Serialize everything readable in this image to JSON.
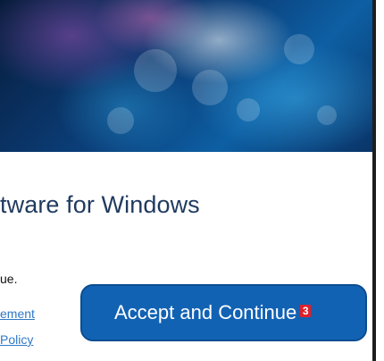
{
  "dialog": {
    "title_fragment": "tware for Windows",
    "body_fragment": "ue.",
    "link1_fragment": "ement",
    "link2_fragment": "Policy",
    "accept_label": "Accept and Continue",
    "accept_badge": "3"
  },
  "colors": {
    "accent_button": "#1262b4",
    "link": "#2f79c6",
    "badge": "#e0202a"
  }
}
